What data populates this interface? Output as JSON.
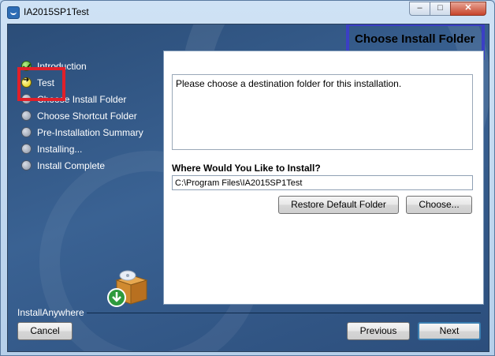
{
  "window": {
    "title": "IA2015SP1Test",
    "controls": {
      "minimize": "–",
      "maximize": "□",
      "close": "✕"
    }
  },
  "header": {
    "title": "Choose Install Folder"
  },
  "steps": [
    {
      "label": "Introduction",
      "state": "done"
    },
    {
      "label": "Test",
      "state": "current"
    },
    {
      "label": "Choose Install Folder",
      "state": "pending"
    },
    {
      "label": "Choose Shortcut Folder",
      "state": "pending"
    },
    {
      "label": "Pre-Installation Summary",
      "state": "pending"
    },
    {
      "label": "Installing...",
      "state": "pending"
    },
    {
      "label": "Install Complete",
      "state": "pending"
    }
  ],
  "main": {
    "message": "Please choose a destination folder for this installation.",
    "where_label": "Where Would You Like to Install?",
    "install_path": "C:\\Program Files\\IA2015SP1Test",
    "restore_label": "Restore Default Folder",
    "choose_label": "Choose..."
  },
  "footer": {
    "brand": "InstallAnywhere",
    "cancel_label": "Cancel",
    "previous_label": "Previous",
    "next_label": "Next"
  },
  "colors": {
    "highlight_red": "#e0202a",
    "highlight_blue": "#3b3fc5",
    "panel_bg": "#2b4d78"
  },
  "icons": [
    "app-icon",
    "checkmark-icon",
    "arrow-right-icon",
    "step-circle-icon",
    "install-box-icon",
    "download-arrow-icon"
  ]
}
